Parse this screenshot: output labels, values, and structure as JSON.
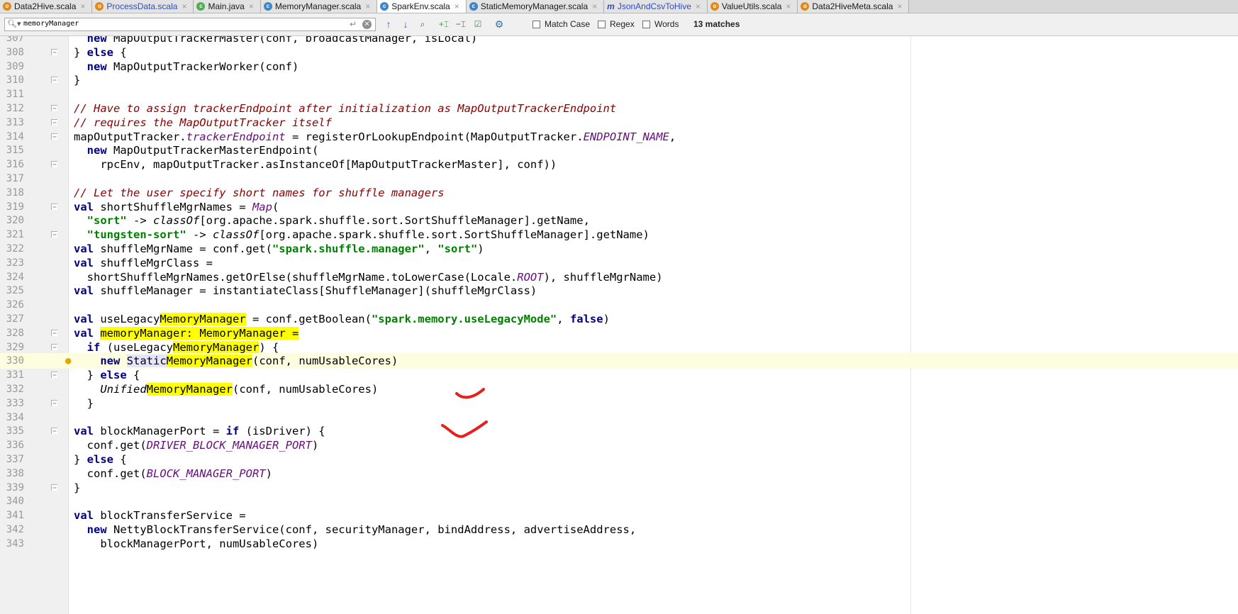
{
  "tabs": [
    {
      "label": "Data2Hive.scala",
      "icon": "scala-object-icon",
      "kind": "obj"
    },
    {
      "label": "ProcessData.scala",
      "icon": "scala-object-icon",
      "kind": "obj",
      "plain": true
    },
    {
      "label": "Main.java",
      "icon": "java-class-icon",
      "kind": "java"
    },
    {
      "label": "MemoryManager.scala",
      "icon": "scala-class-icon",
      "kind": "cls"
    },
    {
      "label": "SparkEnv.scala",
      "icon": "scala-class-icon",
      "kind": "cls",
      "active": true
    },
    {
      "label": "StaticMemoryManager.scala",
      "icon": "scala-class-icon",
      "kind": "cls"
    },
    {
      "label": "JsonAndCsvToHive",
      "icon": "function-icon",
      "kind": "fn",
      "plain": true
    },
    {
      "label": "ValueUtils.scala",
      "icon": "scala-object-icon",
      "kind": "obj"
    },
    {
      "label": "Data2HiveMeta.scala",
      "icon": "scala-object-icon",
      "kind": "obj"
    }
  ],
  "find": {
    "query": "memoryManager",
    "match_case_label": "Match Case",
    "regex_label": "Regex",
    "words_label": "Words",
    "matches_label": "13 matches"
  },
  "editor": {
    "current_line": 330,
    "lines": [
      {
        "n": 307,
        "f": "",
        "s": [
          [
            "",
            "  "
          ],
          [
            "kw",
            "new"
          ],
          [
            "",
            " MapOutputTrackerMaster(conf, broadcastManager, isLocal)"
          ]
        ]
      },
      {
        "n": 308,
        "f": "open",
        "s": [
          [
            "",
            "} "
          ],
          [
            "kw",
            "else"
          ],
          [
            "",
            " {"
          ]
        ]
      },
      {
        "n": 309,
        "f": "",
        "s": [
          [
            "",
            "  "
          ],
          [
            "kw",
            "new"
          ],
          [
            "",
            " MapOutputTrackerWorker(conf)"
          ]
        ]
      },
      {
        "n": 310,
        "f": "close",
        "s": [
          [
            "",
            "}"
          ]
        ]
      },
      {
        "n": 311,
        "f": "",
        "s": []
      },
      {
        "n": 312,
        "f": "open",
        "s": [
          [
            "cm",
            "// Have to assign trackerEndpoint after initialization as MapOutputTrackerEndpoint"
          ]
        ]
      },
      {
        "n": 313,
        "f": "close",
        "s": [
          [
            "cm",
            "// requires the MapOutputTracker itself"
          ]
        ]
      },
      {
        "n": 314,
        "f": "open",
        "s": [
          [
            "",
            "mapOutputTracker."
          ],
          [
            "fld",
            "trackerEndpoint"
          ],
          [
            "",
            " = registerOrLookupEndpoint(MapOutputTracker."
          ],
          [
            "fld",
            "ENDPOINT_NAME"
          ],
          [
            "",
            ","
          ]
        ]
      },
      {
        "n": 315,
        "f": "",
        "s": [
          [
            "",
            "  "
          ],
          [
            "kw",
            "new"
          ],
          [
            "",
            " MapOutputTrackerMasterEndpoint("
          ]
        ]
      },
      {
        "n": 316,
        "f": "close",
        "s": [
          [
            "",
            "    rpcEnv, mapOutputTracker.asInstanceOf[MapOutputTrackerMaster], conf))"
          ]
        ]
      },
      {
        "n": 317,
        "f": "",
        "s": []
      },
      {
        "n": 318,
        "f": "",
        "s": [
          [
            "cm",
            "// Let the user specify short names for shuffle managers"
          ]
        ]
      },
      {
        "n": 319,
        "f": "open",
        "s": [
          [
            "kw",
            "val"
          ],
          [
            "",
            " shortShuffleMgrNames = "
          ],
          [
            "fld",
            "Map"
          ],
          [
            "",
            "("
          ]
        ]
      },
      {
        "n": 320,
        "f": "",
        "s": [
          [
            "",
            "  "
          ],
          [
            "str",
            "\"sort\""
          ],
          [
            "",
            " -> "
          ],
          [
            "ital",
            "classOf"
          ],
          [
            "",
            "[org.apache.spark.shuffle.sort.SortShuffleManager].getName,"
          ]
        ]
      },
      {
        "n": 321,
        "f": "close",
        "s": [
          [
            "",
            "  "
          ],
          [
            "str",
            "\"tungsten-sort\""
          ],
          [
            "",
            " -> "
          ],
          [
            "ital",
            "classOf"
          ],
          [
            "",
            "[org.apache.spark.shuffle.sort.SortShuffleManager].getName)"
          ]
        ]
      },
      {
        "n": 322,
        "f": "",
        "s": [
          [
            "kw",
            "val"
          ],
          [
            "",
            " shuffleMgrName = conf.get("
          ],
          [
            "str",
            "\"spark.shuffle.manager\""
          ],
          [
            "",
            ", "
          ],
          [
            "str",
            "\"sort\""
          ],
          [
            "",
            ")"
          ]
        ]
      },
      {
        "n": 323,
        "f": "",
        "s": [
          [
            "kw",
            "val"
          ],
          [
            "",
            " shuffleMgrClass ="
          ]
        ]
      },
      {
        "n": 324,
        "f": "",
        "s": [
          [
            "",
            "  shortShuffleMgrNames.getOrElse(shuffleMgrName.toLowerCase(Locale."
          ],
          [
            "fld",
            "ROOT"
          ],
          [
            "",
            "), shuffleMgrName)"
          ]
        ]
      },
      {
        "n": 325,
        "f": "",
        "s": [
          [
            "kw",
            "val"
          ],
          [
            "",
            " shuffleManager = instantiateClass[ShuffleManager](shuffleMgrClass)"
          ]
        ]
      },
      {
        "n": 326,
        "f": "",
        "s": []
      },
      {
        "n": 327,
        "f": "",
        "s": [
          [
            "kw",
            "val"
          ],
          [
            "",
            " useLegacy"
          ],
          [
            "hl",
            "MemoryManager"
          ],
          [
            "",
            " = conf.getBoolean("
          ],
          [
            "str",
            "\"spark.memory.useLegacyMode\""
          ],
          [
            "",
            ", "
          ],
          [
            "kw",
            "false"
          ],
          [
            "",
            ")"
          ]
        ]
      },
      {
        "n": 328,
        "f": "open",
        "s": [
          [
            "kw",
            "val"
          ],
          [
            "",
            " "
          ],
          [
            "hl",
            "memoryManager"
          ],
          [
            "hl",
            ": "
          ],
          [
            "hl",
            "MemoryManager"
          ],
          [
            "hl",
            " ="
          ]
        ]
      },
      {
        "n": 329,
        "f": "open",
        "s": [
          [
            "",
            "  "
          ],
          [
            "kw",
            "if"
          ],
          [
            "",
            " (useLegacy"
          ],
          [
            "hl",
            "MemoryManager"
          ],
          [
            "",
            ") {"
          ]
        ]
      },
      {
        "n": 330,
        "f": "",
        "s": [
          [
            "",
            "    "
          ],
          [
            "kw",
            "new"
          ],
          [
            "",
            " "
          ],
          [
            "hl-cur",
            "Static"
          ],
          [
            "hl",
            "MemoryManager"
          ],
          [
            "",
            "(conf, numUsableCores)"
          ]
        ]
      },
      {
        "n": 331,
        "f": "open",
        "s": [
          [
            "",
            "  } "
          ],
          [
            "kw",
            "else"
          ],
          [
            "",
            " {"
          ]
        ]
      },
      {
        "n": 332,
        "f": "",
        "s": [
          [
            "",
            "    "
          ],
          [
            "ital",
            "Unified"
          ],
          [
            "hl",
            "MemoryManager"
          ],
          [
            "",
            "(conf, numUsableCores)"
          ]
        ]
      },
      {
        "n": 333,
        "f": "close",
        "s": [
          [
            "",
            "  }"
          ]
        ]
      },
      {
        "n": 334,
        "f": "",
        "s": []
      },
      {
        "n": 335,
        "f": "open",
        "s": [
          [
            "kw",
            "val"
          ],
          [
            "",
            " blockManagerPort = "
          ],
          [
            "kw",
            "if"
          ],
          [
            "",
            " (isDriver) {"
          ]
        ]
      },
      {
        "n": 336,
        "f": "",
        "s": [
          [
            "",
            "  conf.get("
          ],
          [
            "fld",
            "DRIVER_BLOCK_MANAGER_PORT"
          ],
          [
            "",
            ")"
          ]
        ]
      },
      {
        "n": 337,
        "f": "",
        "s": [
          [
            "",
            "} "
          ],
          [
            "kw",
            "else"
          ],
          [
            "",
            " {"
          ]
        ]
      },
      {
        "n": 338,
        "f": "",
        "s": [
          [
            "",
            "  conf.get("
          ],
          [
            "fld",
            "BLOCK_MANAGER_PORT"
          ],
          [
            "",
            ")"
          ]
        ]
      },
      {
        "n": 339,
        "f": "close",
        "s": [
          [
            "",
            "}"
          ]
        ]
      },
      {
        "n": 340,
        "f": "",
        "s": []
      },
      {
        "n": 341,
        "f": "",
        "s": [
          [
            "kw",
            "val"
          ],
          [
            "",
            " blockTransferService ="
          ]
        ]
      },
      {
        "n": 342,
        "f": "",
        "s": [
          [
            "",
            "  "
          ],
          [
            "kw",
            "new"
          ],
          [
            "",
            " NettyBlockTransferService(conf, securityManager, bindAddress, advertiseAddress,"
          ]
        ]
      },
      {
        "n": 343,
        "f": "",
        "s": [
          [
            "",
            "    blockManagerPort, numUsableCores)"
          ]
        ]
      }
    ]
  },
  "colors": {
    "keyword": "#000080",
    "string": "#008000",
    "comment": "#8b0000",
    "field": "#660e7a",
    "search_highlight": "#ffff00",
    "annotation": "#e8201c"
  }
}
